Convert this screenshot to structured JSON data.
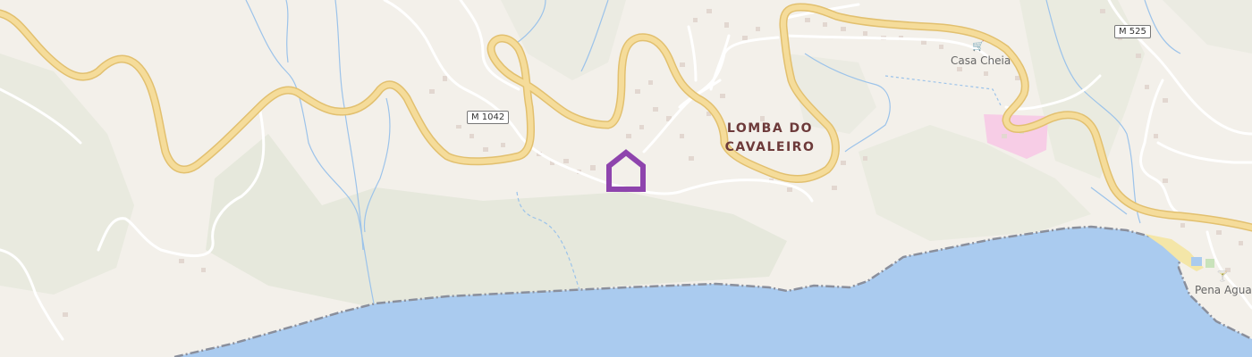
{
  "map": {
    "colors": {
      "land": "#f3f0ea",
      "water": "#aacbef",
      "main_road": "#f5dc9a",
      "main_road_casing": "#e2c06f",
      "minor_road": "#ffffff",
      "stream": "#9cc3ea",
      "scrub": "#e6e8dc",
      "park": "#f7cde6",
      "building": "#e2d7d0",
      "coastline": "#8a8f9c",
      "marker": "#8e44ad"
    },
    "road_shields": [
      {
        "id": "m1042",
        "ref": "M 1042"
      },
      {
        "id": "m525",
        "ref": "M 525"
      }
    ],
    "places": [
      {
        "id": "lomba",
        "line1": "LOMBA DO",
        "line2": "CAVALEIRO"
      }
    ],
    "pois": [
      {
        "id": "casa-cheia",
        "name": "Casa Cheia",
        "icon": "shopping-cart-icon",
        "glyph": "🛒"
      },
      {
        "id": "pena-agua",
        "name": "Pena Agua",
        "icon": "cocktail-bar-icon",
        "glyph": "🍸"
      }
    ],
    "marker": {
      "icon": "home-marker-icon"
    }
  }
}
